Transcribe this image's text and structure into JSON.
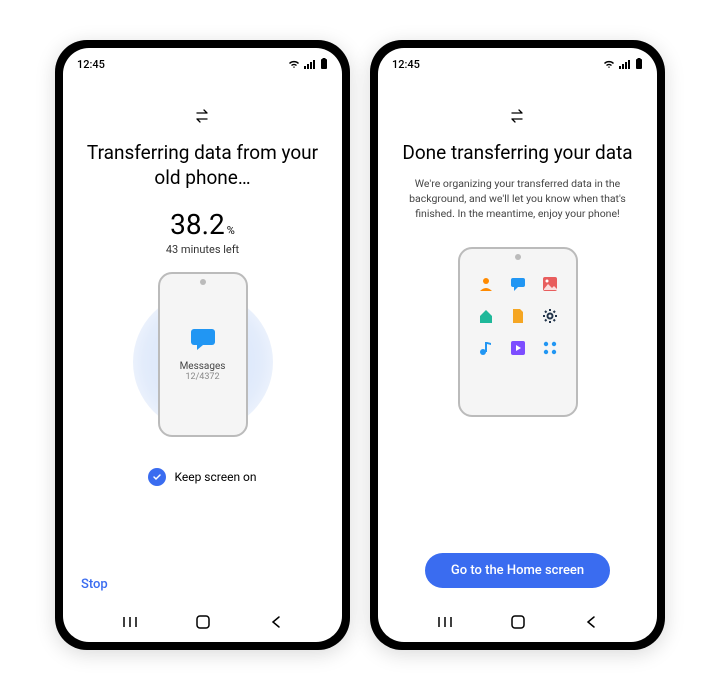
{
  "statusbar": {
    "time": "12:45"
  },
  "left": {
    "title": "Transferring data from your old phone…",
    "percent": "38.2",
    "percent_sign": "%",
    "time_left": "43 minutes left",
    "messages_label": "Messages",
    "messages_count": "12/4372",
    "keep_screen_label": "Keep screen on",
    "stop_label": "Stop"
  },
  "right": {
    "title": "Done transferring your data",
    "subtitle": "We're organizing your transferred data in the background, and we'll let you know when that's finished. In the meantime, enjoy your phone!",
    "cta_label": "Go to the Home screen"
  }
}
